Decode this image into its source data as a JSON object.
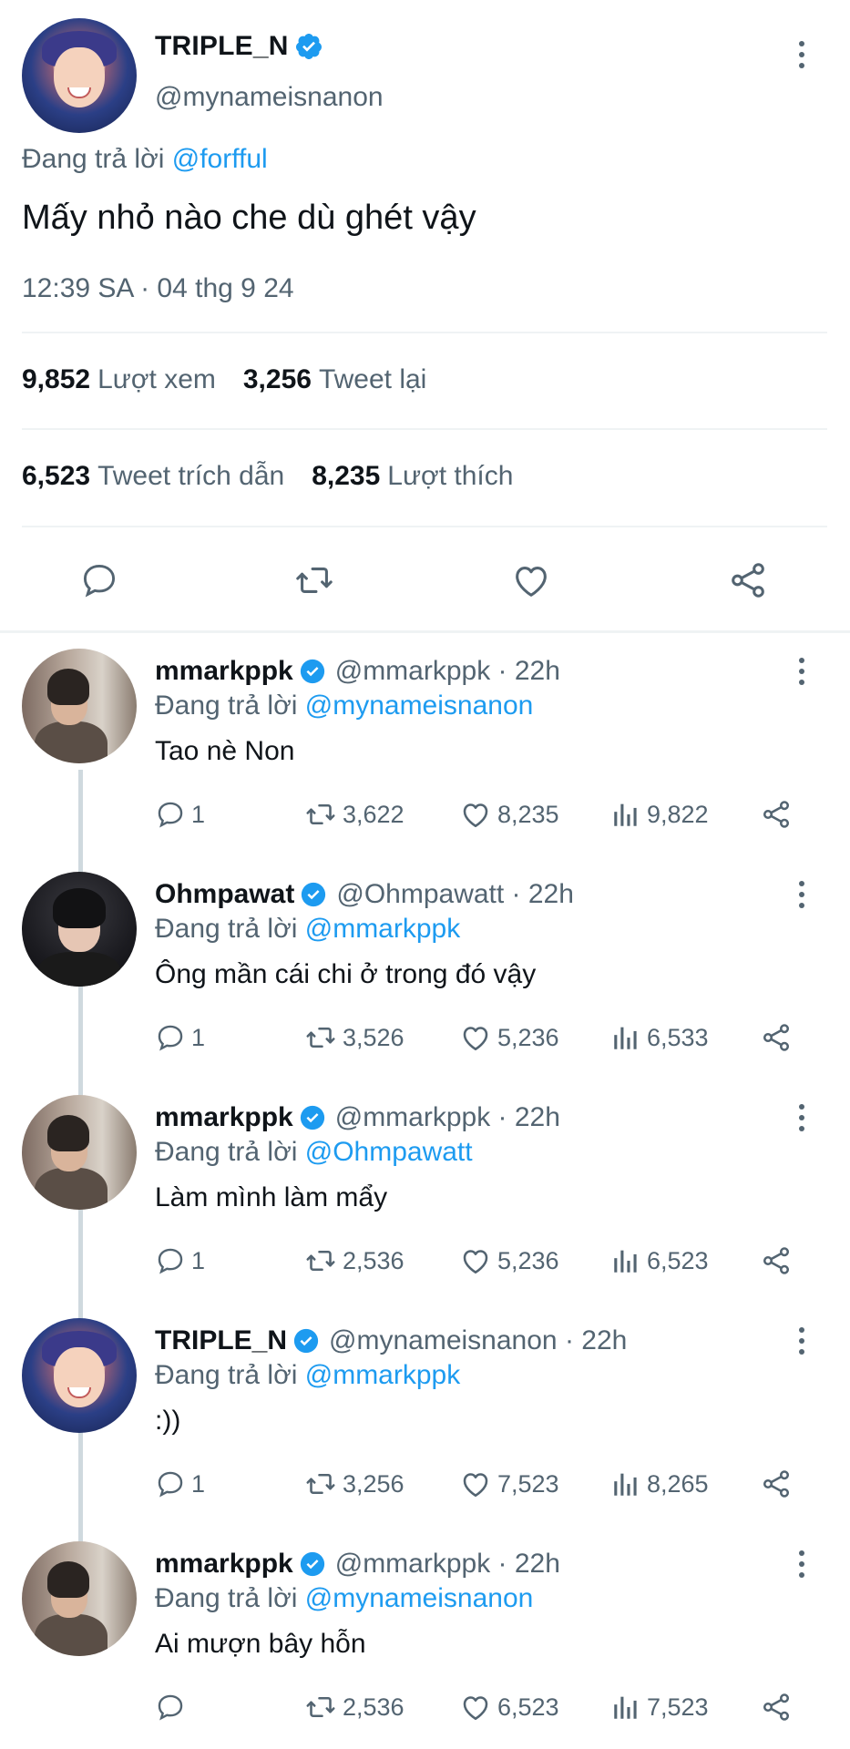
{
  "main_tweet": {
    "name": "TRIPLE_N",
    "handle": "@mynameisnanon",
    "reply_prefix": "Đang trả lời",
    "reply_mention": "@forfful",
    "text": "Mấy nhỏ nào che dù ghét vậy",
    "timestamp": "12:39 SA · 04 thg 9 24",
    "stats": {
      "views_count": "9,852",
      "views_label": "Lượt xem",
      "retweets_count": "3,256",
      "retweets_label": "Tweet lại",
      "quotes_count": "6,523",
      "quotes_label": "Tweet trích dẫn",
      "likes_count": "8,235",
      "likes_label": "Lượt thích"
    }
  },
  "replies": [
    {
      "name": "mmarkppk",
      "handle": "@mmarkppk · 22h",
      "reply_prefix": "Đang trả lời",
      "reply_mention": "@mynameisnanon",
      "text": "Tao nè Non",
      "replies": "1",
      "retweets": "3,622",
      "likes": "8,235",
      "views": "9,822"
    },
    {
      "name": "Ohmpawat",
      "handle": "@Ohmpawatt · 22h",
      "reply_prefix": "Đang trả lời",
      "reply_mention": "@mmarkppk",
      "text": "Ông mần cái chi ở trong đó vậy",
      "replies": "1",
      "retweets": "3,526",
      "likes": "5,236",
      "views": "6,533"
    },
    {
      "name": "mmarkppk",
      "handle": "@mmarkppk · 22h",
      "reply_prefix": "Đang trả lời",
      "reply_mention": "@Ohmpawatt",
      "text": "Làm mình làm mẩy",
      "replies": "1",
      "retweets": "2,536",
      "likes": "5,236",
      "views": "6,523"
    },
    {
      "name": "TRIPLE_N",
      "handle": "@mynameisnanon · 22h",
      "reply_prefix": "Đang trả lời",
      "reply_mention": "@mmarkppk",
      "text": ":))",
      "replies": "1",
      "retweets": "3,256",
      "likes": "7,523",
      "views": "8,265"
    },
    {
      "name": "mmarkppk",
      "handle": "@mmarkppk · 22h",
      "reply_prefix": "Đang trả lời",
      "reply_mention": "@mynameisnanon",
      "text": "Ai mượn bây hỗn",
      "replies": "",
      "retweets": "2,536",
      "likes": "6,523",
      "views": "7,523"
    }
  ],
  "colors": {
    "accent": "#1d9bf0",
    "text": "#0f1419",
    "secondary": "#536471",
    "divider": "#eff3f4"
  }
}
